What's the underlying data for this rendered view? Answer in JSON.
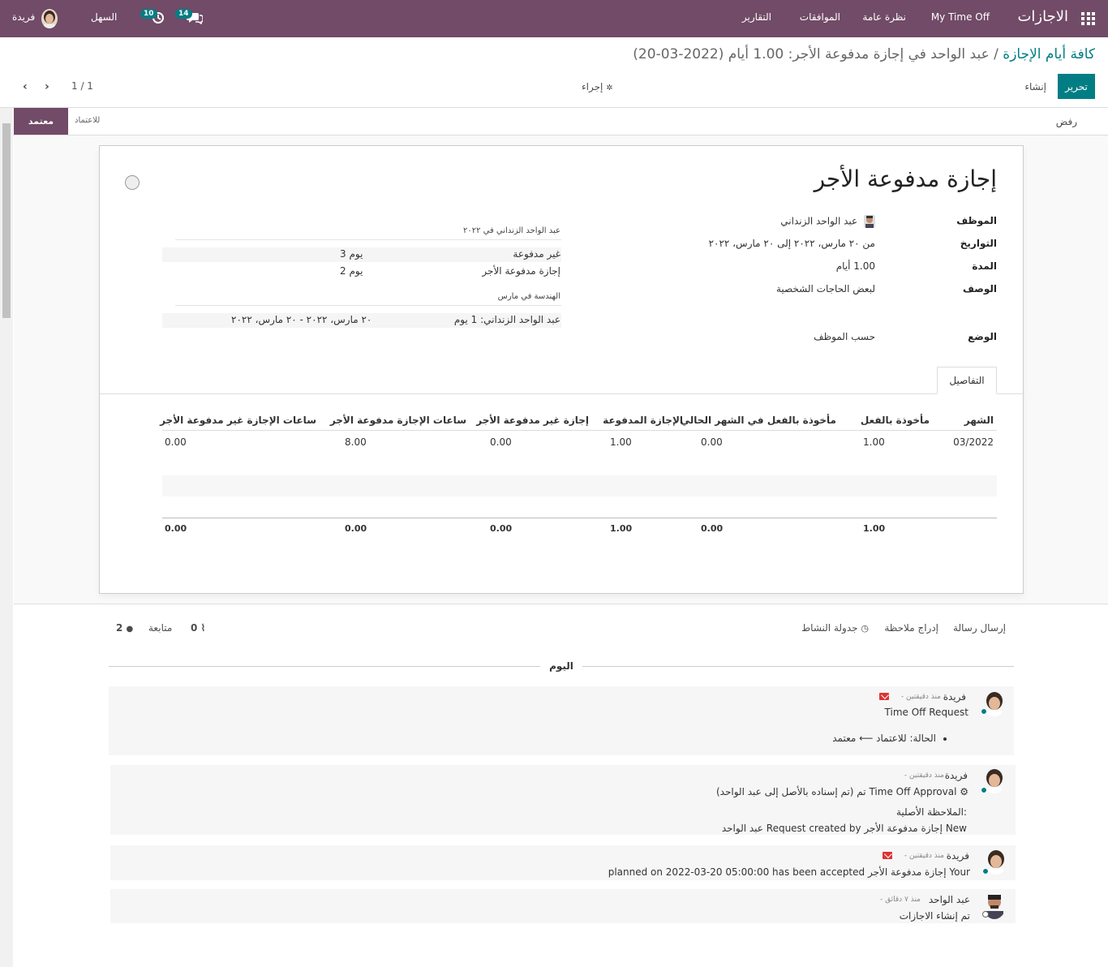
{
  "navbar": {
    "app_title": "الاجازات",
    "menu": [
      "My Time Off",
      "نظرة عامة",
      "الموافقات",
      "التقارير"
    ],
    "chat_badge": "14",
    "activity_badge": "10",
    "company": "السهل",
    "user": "فريدة"
  },
  "breadcrumb": {
    "parent": "كافة أيام الإجازة",
    "separator": "/",
    "current": "عبد الواحد في إجازة مدفوعة الأجر: 1.00 أيام (2022-03-20)"
  },
  "toolbar": {
    "edit": "تحرير",
    "create": "إنشاء",
    "action": "إجراء",
    "pager": "1 / 1"
  },
  "statusbar": {
    "reject": "رفض",
    "to_approve": "للاعتماد",
    "approved": "معتمد"
  },
  "form": {
    "title": "إجازة مدفوعة الأجر",
    "fields": {
      "employee_label": "الموظف",
      "employee": "عبد الواحد الزنداني",
      "dates_label": "التواريخ",
      "dates": "من ٢٠ مارس، ٢٠٢٢ إلى ٢٠ مارس، ٢٠٢٢",
      "duration_label": "المدة",
      "duration": "1.00 أيام",
      "description_label": "الوصف",
      "description": "لبعض الحاجات الشخصية",
      "mode_label": "الوضع",
      "mode": "حسب الموظف"
    },
    "summary": {
      "heading1": "عبد الواحد الزنداني في ٢٠٢٢",
      "rows1": [
        {
          "label": "غير مدفوعة",
          "value": "3 يوم"
        },
        {
          "label": "إجازة مدفوعة الأجر",
          "value": "2 يوم"
        }
      ],
      "heading2": "الهندسة في مارس",
      "row2_label": "عبد الواحد الزنداني:",
      "row2_count": "1 يوم",
      "row2_dates": "٢٠ مارس، ٢٠٢٢ - ٢٠ مارس، ٢٠٢٢"
    },
    "tab": "التفاصيل",
    "table": {
      "headers": [
        "الشهر",
        "مأخوذة بالفعل",
        "مأخوذة بالفعل في الشهر الحالي",
        "الإجازة المدفوعة",
        "إجازة غير مدفوعة الأجر",
        "ساعات الإجازة مدفوعة الأجر",
        "ساعات الإجازة غير مدفوعة الأجر"
      ],
      "row": [
        "03/2022",
        "1.00",
        "0.00",
        "1.00",
        "0.00",
        "8.00",
        "0.00"
      ],
      "totals": [
        "1.00",
        "0.00",
        "1.00",
        "0.00",
        "0.00",
        "0.00"
      ]
    }
  },
  "chatter": {
    "send_message": "إرسال رسالة",
    "log_note": "إدراج ملاحظة",
    "schedule_activity": "جدولة النشاط",
    "followers_label": "متابعة",
    "followers_count": "2",
    "attachments_count": "0",
    "today": "اليوم",
    "messages": [
      {
        "author": "فريدة",
        "date": "- منذ دقيقتين",
        "line1": "Time Off Request",
        "tracking": "الحالة: للاعتماد ⟵ معتمد"
      },
      {
        "author": "فريدة",
        "date": "- منذ دقيقتين",
        "line1": "Time Off Approval تم (تم إسناده بالأصل إلى عبد الواحد)",
        "line2": "الملاحظة الأصلية:",
        "line3": "New إجازة مدفوعة الأجر Request created by عبد الواحد"
      },
      {
        "author": "فريدة",
        "date": "- منذ دقيقتين",
        "line1": "Your إجازة مدفوعة الأجر planned on 2022-03-20 05:00:00 has been accepted"
      },
      {
        "author": "عبد الواحد",
        "date": "- منذ ٧ دقائق",
        "line1": "تم إنشاء الاجازات"
      }
    ]
  },
  "colors": {
    "brand": "#714b67",
    "accent": "#017e84",
    "online": "#017e84"
  }
}
